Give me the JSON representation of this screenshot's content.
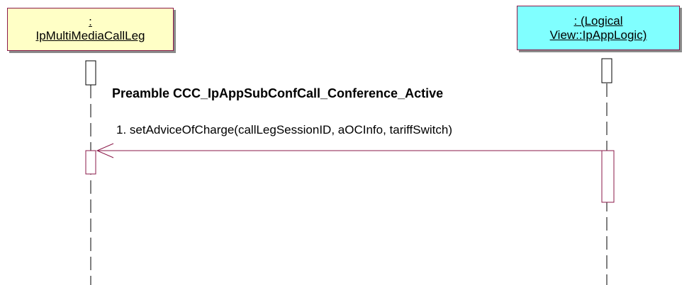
{
  "objects": {
    "left": {
      "line1": ":",
      "line2": "IpMultiMediaCallLeg"
    },
    "right": {
      "line1": ": (Logical",
      "line2": "View::IpAppLogic)"
    }
  },
  "preamble": "Preamble CCC_IpAppSubConfCall_Conference_Active",
  "messages": [
    {
      "label": "1. setAdviceOfCharge(callLegSessionID, aOCInfo, tariffSwitch)"
    }
  ],
  "colors": {
    "line": "#8b1a4a",
    "left_box_fill": "#ffffc6",
    "right_box_fill": "#80ffff"
  }
}
